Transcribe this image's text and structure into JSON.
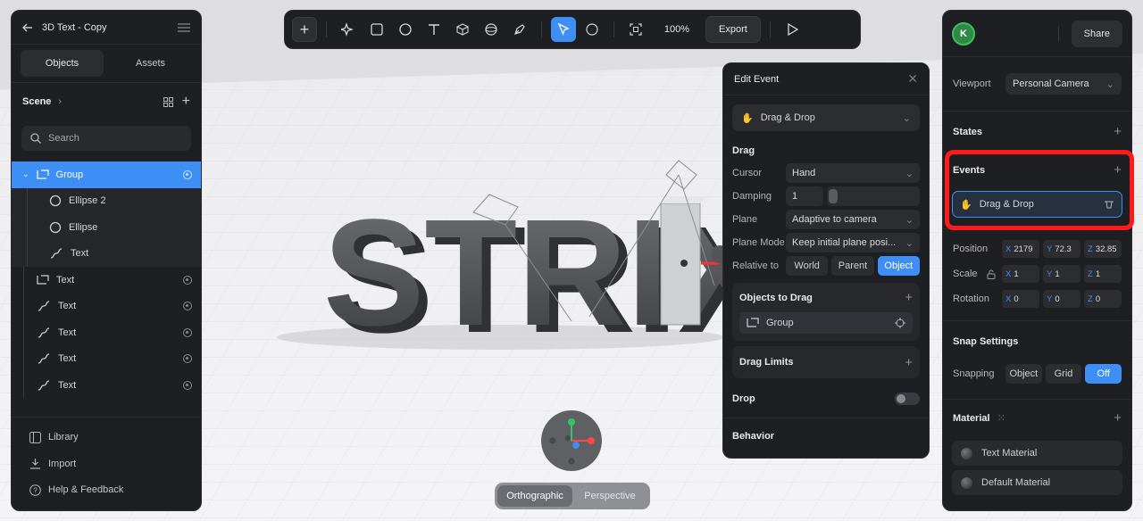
{
  "project": {
    "title": "3D Text - Copy"
  },
  "left_panel": {
    "tabs": [
      "Objects",
      "Assets"
    ],
    "scene_label": "Scene",
    "search_placeholder": "Search",
    "layers": [
      {
        "name": "Group",
        "icon": "group-icon",
        "selected": true
      },
      {
        "name": "Ellipse 2",
        "icon": "ellipse-icon",
        "child": true
      },
      {
        "name": "Ellipse",
        "icon": "ellipse-icon",
        "child": true
      },
      {
        "name": "Text",
        "icon": "path-icon",
        "child": true
      },
      {
        "name": "Text",
        "icon": "group-icon"
      },
      {
        "name": "Text",
        "icon": "path-icon"
      },
      {
        "name": "Text",
        "icon": "path-icon"
      },
      {
        "name": "Text",
        "icon": "path-icon"
      },
      {
        "name": "Text",
        "icon": "path-icon"
      }
    ],
    "footer": [
      "Library",
      "Import",
      "Help & Feedback"
    ]
  },
  "toolbar": {
    "zoom": "100%",
    "export_label": "Export"
  },
  "viewport": {
    "scene_text": "STRIX",
    "view_modes": [
      "Orthographic",
      "Perspective"
    ],
    "active_view": "Orthographic"
  },
  "edit_event": {
    "title": "Edit Event",
    "event_type": "Drag & Drop",
    "drag_section": "Drag",
    "properties": {
      "cursor_label": "Cursor",
      "cursor_value": "Hand",
      "damping_label": "Damping",
      "damping_value": "1",
      "plane_label": "Plane",
      "plane_value": "Adaptive to camera",
      "plane_mode_label": "Plane Mode",
      "plane_mode_value": "Keep initial plane posi...",
      "relative_label": "Relative to",
      "relative_options": [
        "World",
        "Parent",
        "Object"
      ],
      "relative_selected": "Object"
    },
    "objects_to_drag": {
      "label": "Objects to Drag",
      "item": "Group"
    },
    "drag_limits_label": "Drag Limits",
    "drop_label": "Drop",
    "behavior_label": "Behavior"
  },
  "right_panel": {
    "avatar_initial": "K",
    "share_label": "Share",
    "viewport_label": "Viewport",
    "viewport_value": "Personal Camera",
    "states_label": "States",
    "events_label": "Events",
    "event_item": "Drag & Drop",
    "position_label": "Position",
    "position": {
      "x": "2179",
      "y": "72.3",
      "z": "32.85"
    },
    "scale_label": "Scale",
    "scale": {
      "x": "1",
      "y": "1",
      "z": "1"
    },
    "rotation_label": "Rotation",
    "rotation": {
      "x": "0",
      "y": "0",
      "z": "0"
    },
    "snap_label": "Snap Settings",
    "snapping_label": "Snapping",
    "snapping_options": [
      "Object",
      "Grid",
      "Off"
    ],
    "snapping_selected": "Off",
    "material_label": "Material",
    "materials": [
      "Text Material",
      "Default Material"
    ]
  },
  "colors": {
    "accent": "#3d8ff5",
    "panel": "#1e1f22",
    "highlight": "#ff1a1a",
    "avatar": "#2d8a45"
  }
}
